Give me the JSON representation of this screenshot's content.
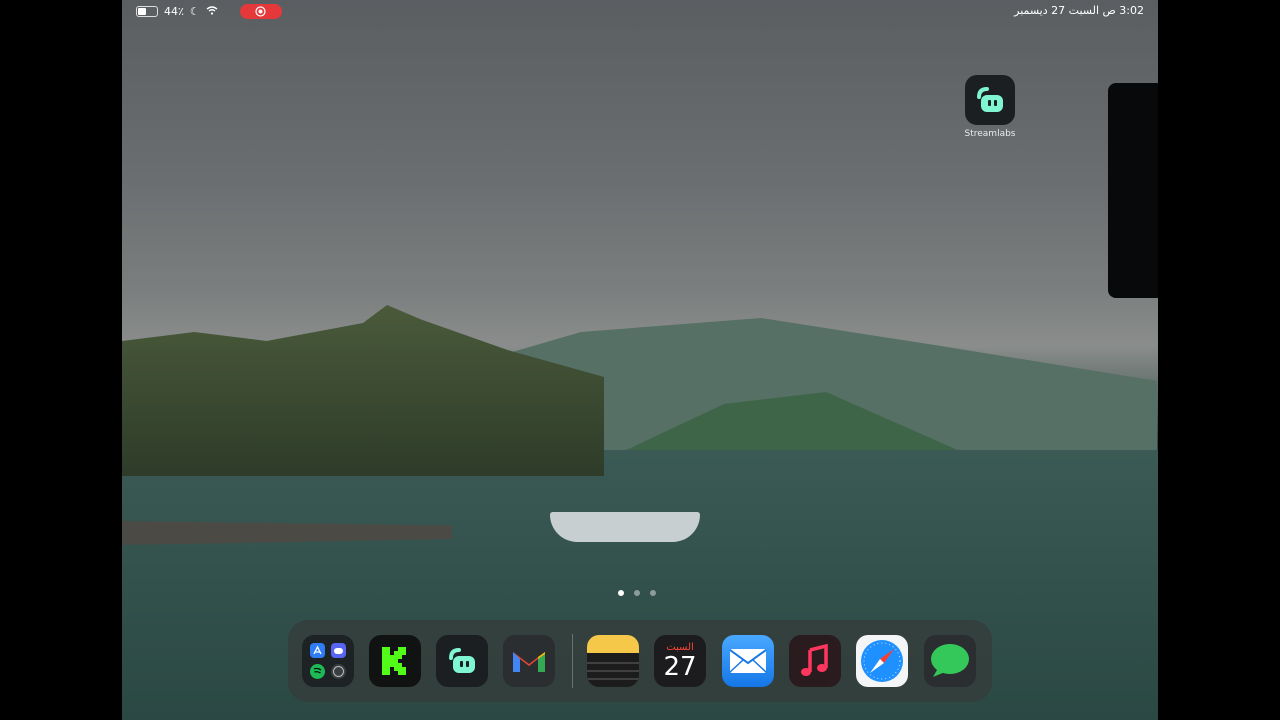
{
  "status_bar": {
    "time_date": "3:02 ص  السبت 27 ديسمبر",
    "battery_text": "44٪"
  },
  "desktop_apps": [
    {
      "label": "Streamlabs"
    }
  ],
  "page_dots": 3,
  "dock": {
    "apps": [
      {
        "name": "Apps folder (App Store, Discord, Spotify, Safari)"
      },
      {
        "name": "Kick"
      },
      {
        "name": "Streamlabs"
      },
      {
        "name": "Gmail"
      },
      {
        "name": "Notes"
      },
      {
        "name": "Calendar",
        "weekday": "السبت",
        "day": "27"
      },
      {
        "name": "Mail"
      },
      {
        "name": "Music"
      },
      {
        "name": "Safari"
      },
      {
        "name": "Messages"
      }
    ]
  },
  "colors": {
    "record_indicator": "#e5383b",
    "kick_green": "#53fc18",
    "streamlabs_mint": "#80f5d2"
  }
}
